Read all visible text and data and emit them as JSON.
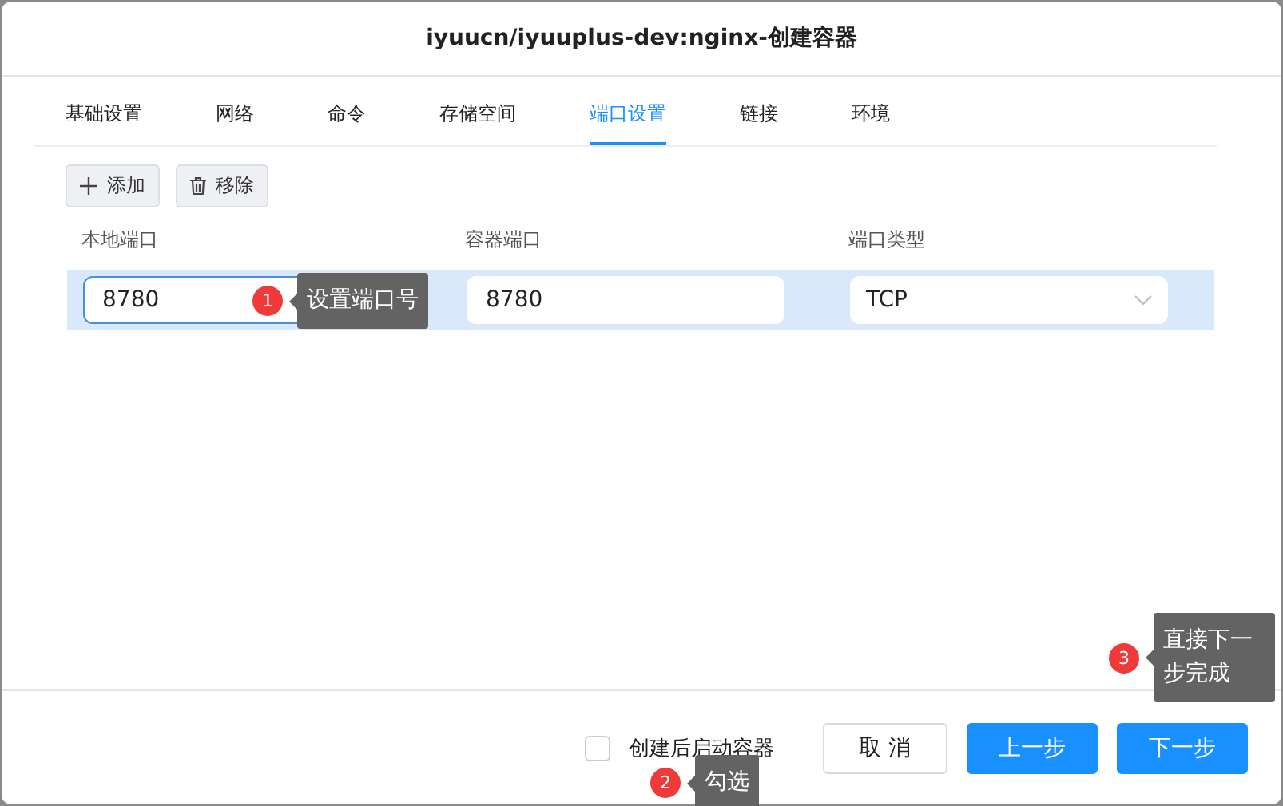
{
  "dialog": {
    "title": "iyuucn/iyuuplus-dev:nginx-创建容器"
  },
  "tabs": [
    {
      "label": "基础设置",
      "selected": false
    },
    {
      "label": "网络",
      "selected": false
    },
    {
      "label": "命令",
      "selected": false
    },
    {
      "label": "存储空间",
      "selected": false
    },
    {
      "label": "端口设置",
      "selected": true
    },
    {
      "label": "链接",
      "selected": false
    },
    {
      "label": "环境",
      "selected": false
    }
  ],
  "toolbar": [
    {
      "kind": "add",
      "label": "添加"
    },
    {
      "kind": "remove",
      "label": "移除"
    }
  ],
  "table": {
    "columns": [
      "本地端口",
      "容器端口",
      "端口类型"
    ],
    "rows": [
      {
        "selected": true,
        "local_port": "8780",
        "container_port": "8780",
        "port_type": "TCP"
      }
    ]
  },
  "footer": {
    "checkbox": {
      "label": "创建后启动容器",
      "checked": false
    },
    "buttons": [
      {
        "kind": "secondary",
        "label": "取 消"
      },
      {
        "kind": "primary",
        "label": "上一步"
      },
      {
        "kind": "primary",
        "label": "下一步"
      }
    ]
  },
  "annotations": [
    {
      "number": "1",
      "text": "设置端口号"
    },
    {
      "number": "2",
      "text": "勾选"
    },
    {
      "number": "3",
      "text": "直接下一步完成"
    }
  ]
}
